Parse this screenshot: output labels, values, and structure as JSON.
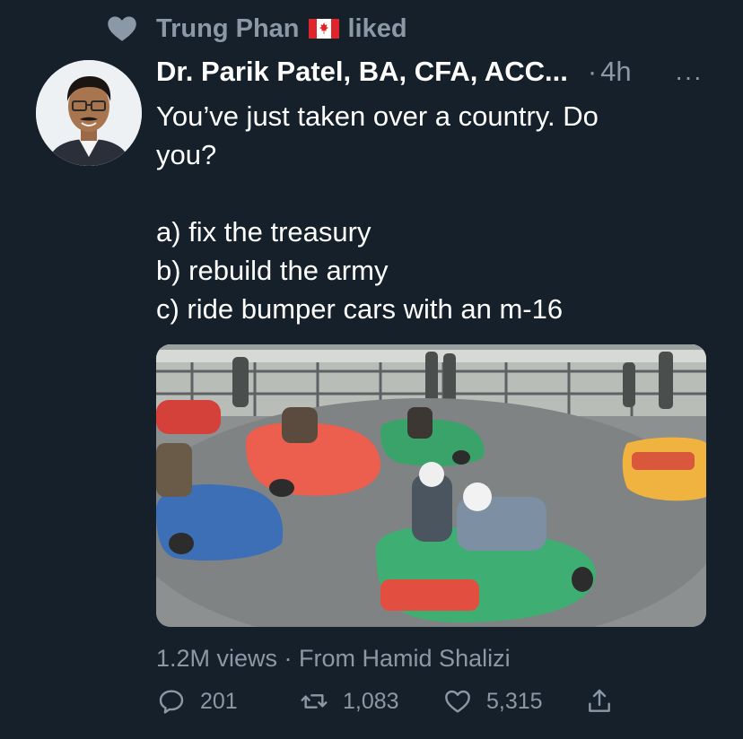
{
  "social_context": {
    "user": "Trung Phan",
    "action": "liked",
    "flag": "canada-flag-emoji"
  },
  "tweet": {
    "display_name": "Dr. Parik Patel, BA, CFA, ACC...",
    "dot": "·",
    "timestamp": "4h",
    "more": "···",
    "text_lines": [
      "You’ve just taken over a country. Do",
      "you?",
      "a) fix the treasury",
      "b) rebuild the army",
      "c) ride bumper cars with an m-16"
    ],
    "media_description_icon": "bumper-cars-video",
    "views": "1.2M views",
    "views_separator": " · ",
    "source": "From Hamid Shalizi"
  },
  "actions": {
    "reply_count": "201",
    "retweet_count": "1,083",
    "like_count": "5,315"
  },
  "colors": {
    "background": "#15202b",
    "secondary_text": "#8b98a5",
    "primary_text": "#ffffff"
  }
}
